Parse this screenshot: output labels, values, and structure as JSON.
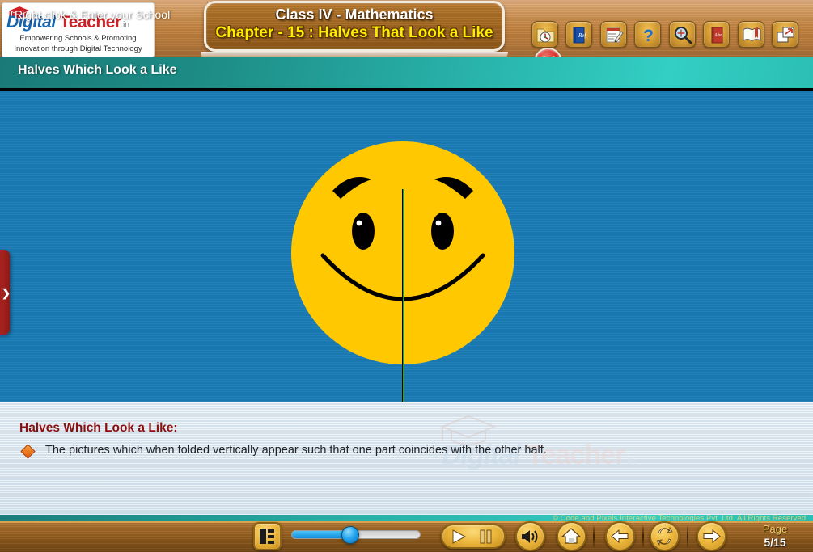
{
  "logo": {
    "name_part1": "Digital",
    "name_part2": " Teacher",
    "domain": ".in",
    "tagline_line1": "Empowering Schools & Promoting",
    "tagline_line2": "Innovation through Digital Technology",
    "cap_icon": "graduation-cap-icon"
  },
  "header": {
    "title_line1": "Class IV - Mathematics",
    "title_line2": "Chapter - 15 : Halves That Look a Like",
    "section_title": "Halves Which Look a Like"
  },
  "toolbar": {
    "buttons": [
      {
        "name": "clock-folder-icon",
        "label": "Time"
      },
      {
        "name": "reference-book-icon",
        "label": "Ref"
      },
      {
        "name": "notes-pencil-icon",
        "label": "Notes"
      },
      {
        "name": "help-question-icon",
        "label": "?"
      },
      {
        "name": "magnifier-zoom-icon",
        "label": "Zoom"
      },
      {
        "name": "abc-dictionary-icon",
        "label": "Abc"
      },
      {
        "name": "open-book-icon",
        "label": "Book"
      },
      {
        "name": "restore-window-icon",
        "label": "Restore"
      },
      {
        "name": "close-icon",
        "label": "Close"
      }
    ]
  },
  "stage": {
    "left_flyout_chevron": "❯",
    "illustration": "smiley-face-with-vertical-symmetry-line",
    "face_color": "#FFC800",
    "symmetry_line_color": "#00C400",
    "background_color": "#1B7CB6"
  },
  "panel": {
    "heading": "Halves Which Look a Like:",
    "bullet_text": "The pictures which when folded vertically appear such that one part coincides with the other half.",
    "bullet_icon": "orange-diamond-bullet",
    "watermark_part1": "Digital",
    "watermark_part2": " Teacher",
    "watermark_domain": ".in"
  },
  "footer": {
    "copyright": "© Code and Pixels Interactive Technologies  Pvt. Ltd. All Rights Reserved.",
    "hint": "Right click & Enter your School",
    "progress_percent": 45,
    "page_label": "Page",
    "page_value": "5/15",
    "controls": [
      {
        "name": "sitemap-index-icon",
        "label": "Index"
      },
      {
        "name": "play-icon",
        "label": "Play"
      },
      {
        "name": "pause-icon",
        "label": "Pause"
      },
      {
        "name": "volume-speaker-icon",
        "label": "Volume"
      },
      {
        "name": "home-icon",
        "label": "Home"
      },
      {
        "name": "previous-arrow-icon",
        "label": "Previous"
      },
      {
        "name": "refresh-replay-icon",
        "label": "Replay"
      },
      {
        "name": "next-arrow-icon",
        "label": "Next"
      }
    ]
  }
}
